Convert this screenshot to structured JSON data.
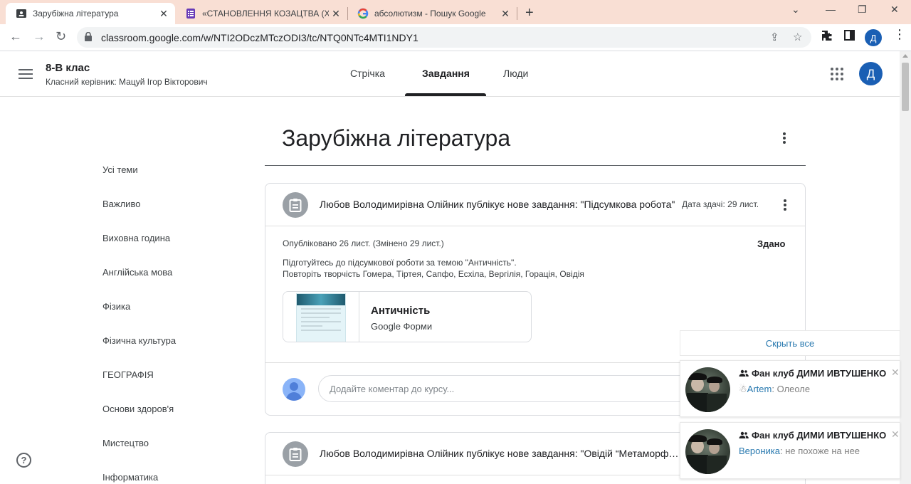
{
  "browser": {
    "tabs": [
      {
        "title": "Зарубіжна література",
        "close": "✕"
      },
      {
        "title": "«СТАНОВЛЕННЯ КОЗАЦТВА (XV",
        "close": "✕"
      },
      {
        "title": "абсолютизм - Пошук Google",
        "close": "✕"
      }
    ],
    "new_tab": "+",
    "url": "classroom.google.com/w/NTI2ODczMTczODI3/tc/NTQ0NTc4MTI1NDY1",
    "profile_letter": "Д"
  },
  "classroom": {
    "class_name": "8-В клас",
    "teacher": "Класний керівник: Мацуй Ігор Вікторович",
    "tabs": [
      "Стрічка",
      "Завдання",
      "Люди"
    ],
    "active_tab": "Завдання",
    "avatar_letter": "Д"
  },
  "sidebar": {
    "topics": [
      "Усі теми",
      "Важливо",
      "Виховна година",
      "Англійська мова",
      "Фізика",
      "Фізична культура",
      "ГЕОГРАФІЯ",
      "Основи здоров'я",
      "Мистецтво",
      "Інформатика"
    ],
    "help": "?"
  },
  "main": {
    "topic_title": "Зарубіжна література",
    "assignments": [
      {
        "title": "Любов Володимирівна Олійник публікує нове завдання: \"Підсумкова робота\"",
        "due": "Дата здачі: 29 лист.",
        "published": "Опубліковано 26 лист. (Змінено 29 лист.)",
        "status": "Здано",
        "description": [
          "Підготуйтесь до підсумкової роботи за темою \"Античність\".",
          "Повторіть творчість Гомера, Тіртея, Сапфо, Есхіла, Вергілія, Горація, Овідія"
        ],
        "attachment": {
          "title": "Античність",
          "type": "Google Форми"
        },
        "comment_placeholder": "Додайте коментар до курсу..."
      },
      {
        "title": "Любов Володимирівна Олійник публікує нове завдання: \"Овідій “Метаморфози”\""
      }
    ]
  },
  "notifications": {
    "hide_all": "Скрыть все",
    "items": [
      {
        "group": "Фан клуб ДИМИ ИВТУШЕНКО",
        "author_icon": "☃",
        "author": "Artem",
        "text": "Олеоле",
        "close": "✕"
      },
      {
        "group": "Фан клуб ДИМИ ИВТУШЕНКО",
        "author_icon": "",
        "author": "Вероника",
        "text": "не похоже на нее",
        "close": "✕"
      }
    ]
  },
  "colors": {
    "tabbar": "#f9dfd4",
    "accent_blue": "#1a5fb4",
    "link_blue": "#2a7ab0"
  },
  "icons": [
    "classroom-icon",
    "forms-icon",
    "google-icon",
    "back-icon",
    "forward-icon",
    "reload-icon",
    "lock-icon",
    "share-icon",
    "star-icon",
    "extensions-icon",
    "sidepanel-icon",
    "menu-dots-icon",
    "hamburger-icon",
    "apps-grid-icon",
    "help-icon",
    "assignment-icon",
    "more-vert-icon",
    "group-icon",
    "close-icon"
  ]
}
